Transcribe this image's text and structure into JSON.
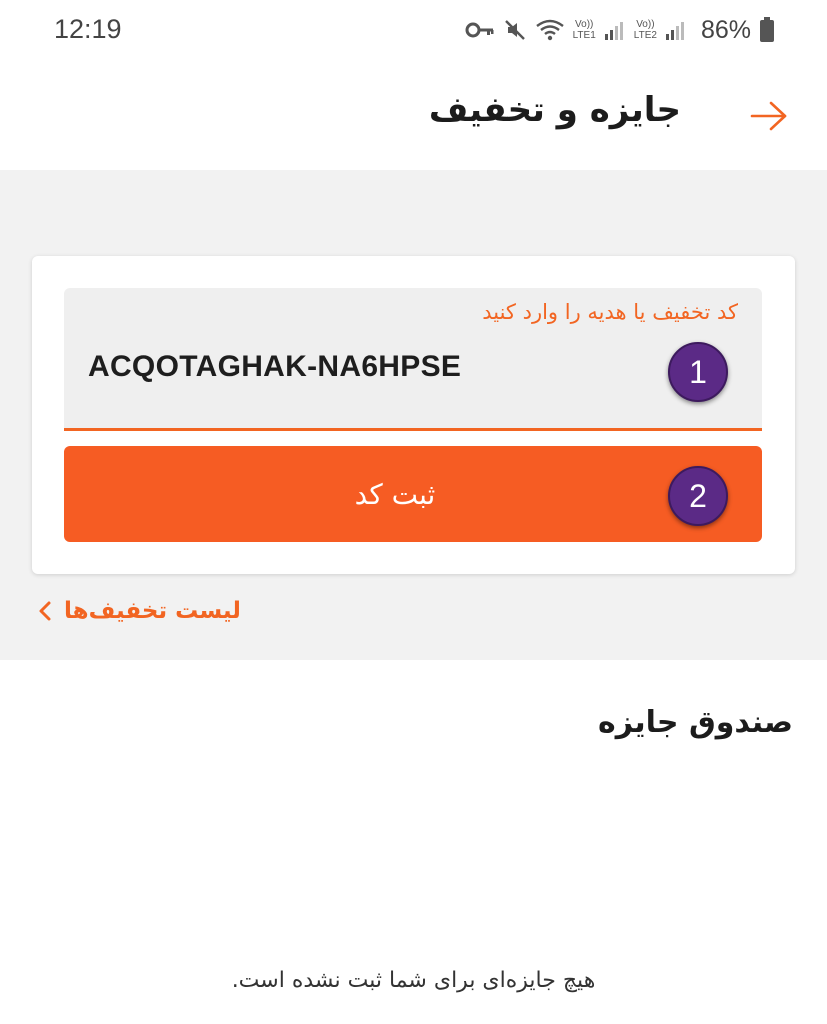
{
  "status_bar": {
    "time": "12:19",
    "sim1_label": "Vo)) LTE1",
    "sim2_label": "Vo)) LTE2",
    "battery": "86%",
    "icons": [
      "key-icon",
      "mute-icon",
      "wifi-icon",
      "signal-icon",
      "battery-icon"
    ]
  },
  "header": {
    "title": "جایزه و تخفیف",
    "back_icon": "arrow-right-icon"
  },
  "code_form": {
    "label": "کد تخفیف یا هدیه را وارد کنید",
    "value": "ACQOTAGHAK-NA6HPSE",
    "submit_label": "ثبت کد",
    "badge_1": "1",
    "badge_2": "2"
  },
  "discount_list_link": {
    "label": "لیست تخفیف‌ها",
    "icon": "chevron-left-icon"
  },
  "prize_box": {
    "title": "صندوق جایزه",
    "empty_message": "هیچ جایزه‌ای برای شما ثبت نشده است."
  },
  "colors": {
    "accent": "#f26522",
    "button": "#f65c23",
    "badge": "#5b2a86",
    "section_bg": "#f2f2f2"
  }
}
